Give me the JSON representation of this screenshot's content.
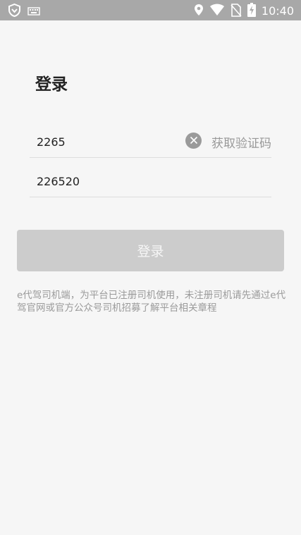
{
  "status_bar": {
    "time": "10:40",
    "left_icons": [
      "shield-icon",
      "keyboard-icon"
    ],
    "right_icons": [
      "location-icon",
      "wifi-icon",
      "no-sim-icon",
      "battery-charging-icon"
    ]
  },
  "login": {
    "title": "登录",
    "phone_value": "2265",
    "get_code_label": "获取验证码",
    "code_value": "226520",
    "submit_label": "登录",
    "notice": "e代驾司机端，为平台已注册司机使用，未注册司机请先通过e代驾官网或官方公众号司机招募了解平台相关章程"
  },
  "colors": {
    "status_bar_bg": "#a8a8a8",
    "page_bg": "#f6f6f6",
    "button_disabled_bg": "#cccccc",
    "muted_text": "#999999"
  }
}
